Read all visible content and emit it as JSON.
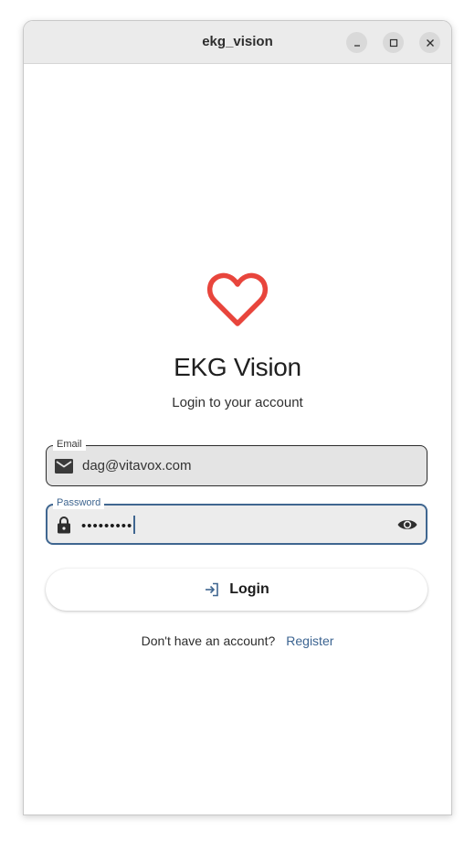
{
  "window": {
    "title": "ekg_vision",
    "controls": {
      "minimize": "minimize-icon",
      "maximize": "maximize-icon",
      "close": "close-icon"
    }
  },
  "app": {
    "logo_icon": "heart-icon",
    "logo_color": "#e8453c",
    "name": "EKG Vision",
    "subtitle": "Login to your account"
  },
  "form": {
    "email": {
      "label": "Email",
      "value": "dag@vitavox.com",
      "icon": "mail-icon"
    },
    "password": {
      "label": "Password",
      "value": "•••••••••",
      "icon": "lock-icon",
      "toggle_icon": "eye-icon",
      "focused": true
    },
    "login_button": {
      "label": "Login",
      "icon": "login-icon"
    },
    "register": {
      "prompt": "Don't have an account?",
      "link": "Register"
    }
  },
  "colors": {
    "accent": "#3f6690",
    "link": "#3c6491",
    "logo": "#e8453c"
  }
}
